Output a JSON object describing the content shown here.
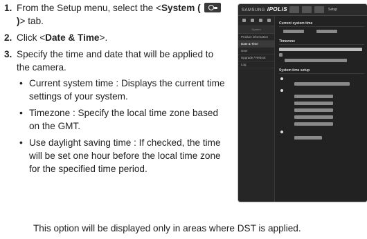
{
  "steps": [
    {
      "num": "1.",
      "pre": "From the Setup menu, select the <",
      "bold": "System ( ",
      "bold2": " )",
      "post": "> tab."
    },
    {
      "num": "2.",
      "pre": "Click <",
      "bold": "Date & Time",
      "post": ">."
    },
    {
      "num": "3.",
      "text": "Specify the time and date that will be applied to the camera."
    }
  ],
  "bullets": [
    "Current system time : Displays the current time settings of your system.",
    "Timezone : Specify the local time zone based on the GMT.",
    "Use daylight saving time : If checked, the time will be set one hour before the local time zone for the specified time period."
  ],
  "note": "This option will be displayed only in areas where DST is applied.",
  "screenshot": {
    "brand": "SAMSUNG",
    "brand_em": "iPOLiS",
    "setup_label": "Setup",
    "side_head": "System",
    "side_items": [
      "Product information",
      "Date & Time",
      "User",
      "Upgrade / Reboot",
      "Log"
    ],
    "sections": [
      "Current system time",
      "Timezone",
      "System time setup"
    ]
  }
}
